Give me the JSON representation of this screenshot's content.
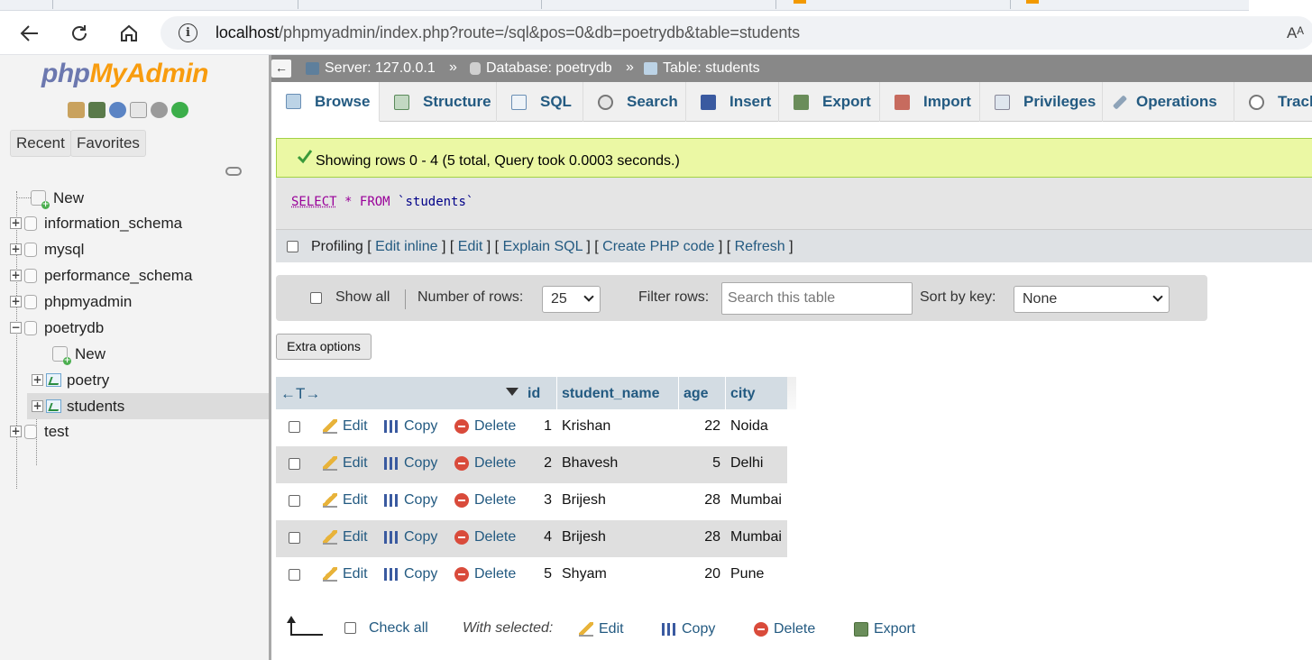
{
  "browser": {
    "url_host": "localhost",
    "url_path": "/phpmyadmin/index.php?route=/sql&pos=0&db=poetrydb&table=students",
    "read_aloud": "Aᴬ"
  },
  "nav": {
    "logo_php": "php",
    "logo_myadmin": "MyAdmin",
    "recent_label": "Recent",
    "favorites_label": "Favorites",
    "tree": [
      {
        "label": "New"
      },
      {
        "label": "information_schema"
      },
      {
        "label": "mysql"
      },
      {
        "label": "performance_schema"
      },
      {
        "label": "phpmyadmin"
      },
      {
        "label": "poetrydb"
      },
      {
        "label": "New"
      },
      {
        "label": "poetry"
      },
      {
        "label": "students"
      },
      {
        "label": "test"
      }
    ]
  },
  "breadcrumb": {
    "server": "Server: 127.0.0.1",
    "database": "Database: poetrydb",
    "table": "Table: students",
    "separator": "»"
  },
  "tabs": [
    {
      "label": "Browse"
    },
    {
      "label": "Structure"
    },
    {
      "label": "SQL"
    },
    {
      "label": "Search"
    },
    {
      "label": "Insert"
    },
    {
      "label": "Export"
    },
    {
      "label": "Import"
    },
    {
      "label": "Privileges"
    },
    {
      "label": "Operations"
    },
    {
      "label": "Track"
    }
  ],
  "result": {
    "message": "Showing rows 0 - 4 (5 total, Query took 0.0003 seconds.)",
    "sql_select": "SELECT",
    "sql_star": "*",
    "sql_from": "FROM",
    "sql_table": "`students`"
  },
  "profiling": {
    "label": "Profiling",
    "links": [
      "Edit inline",
      "Edit",
      "Explain SQL",
      "Create PHP code",
      "Refresh"
    ]
  },
  "navbar": {
    "show_all": "Show all",
    "rows_label": "Number of rows:",
    "rows_value": "25",
    "filter_label": "Filter rows:",
    "filter_placeholder": "Search this table",
    "sort_label": "Sort by key:",
    "sort_value": "None"
  },
  "extra_options": "Extra options",
  "table": {
    "arrows": "←T→",
    "columns": [
      "id",
      "student_name",
      "age",
      "city"
    ],
    "actions": {
      "edit": "Edit",
      "copy": "Copy",
      "delete": "Delete"
    },
    "rows": [
      {
        "id": "1",
        "student_name": "Krishan",
        "age": "22",
        "city": "Noida"
      },
      {
        "id": "2",
        "student_name": "Bhavesh",
        "age": "5",
        "city": "Delhi"
      },
      {
        "id": "3",
        "student_name": "Brijesh",
        "age": "28",
        "city": "Mumbai"
      },
      {
        "id": "4",
        "student_name": "Brijesh",
        "age": "28",
        "city": "Mumbai"
      },
      {
        "id": "5",
        "student_name": "Shyam",
        "age": "20",
        "city": "Pune"
      }
    ]
  },
  "bottom": {
    "check_all": "Check all",
    "with_selected": "With selected:",
    "edit": "Edit",
    "copy": "Copy",
    "delete": "Delete",
    "export": "Export"
  },
  "colors": {
    "link": "#235a81",
    "success_bg": "#ebf8a4",
    "header_bg": "#d3dce3"
  }
}
